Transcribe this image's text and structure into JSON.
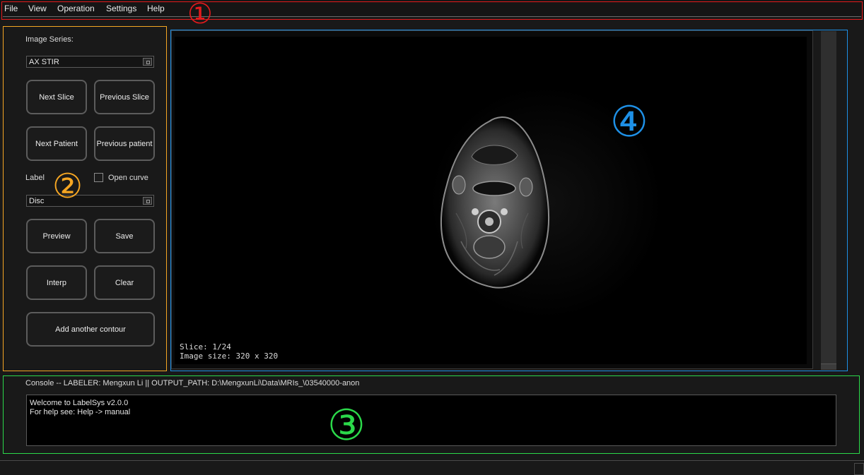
{
  "menu": {
    "items": [
      "File",
      "View",
      "Operation",
      "Settings",
      "Help"
    ]
  },
  "annotations": {
    "menu_marker": "①",
    "controls_marker": "②",
    "console_marker": "③",
    "viewer_marker": "④",
    "colors": {
      "menu": "#e41a1c",
      "controls": "#f5a623",
      "console": "#2bd94a",
      "viewer": "#1e90e6"
    }
  },
  "controls": {
    "series_label": "Image Series:",
    "series_value": "AX STIR",
    "next_slice": "Next Slice",
    "previous_slice": "Previous Slice",
    "next_patient": "Next Patient",
    "previous_patient": "Previous patient",
    "label_label": "Label",
    "open_curve_label": "Open curve",
    "open_curve_checked": false,
    "label_value": "Disc",
    "preview": "Preview",
    "save": "Save",
    "interp": "Interp",
    "clear": "Clear",
    "add_contour": "Add another contour"
  },
  "viewer": {
    "slice_text": "Slice: 1/24",
    "size_text": "Image size: 320 x 320"
  },
  "console": {
    "header": "Console -- LABELER: Mengxun Li || OUTPUT_PATH: D:\\MengxunLi\\Data\\MRIs_\\03540000-anon",
    "lines": [
      "Welcome to LabelSys v2.0.0",
      "For help see: Help -> manual"
    ]
  }
}
